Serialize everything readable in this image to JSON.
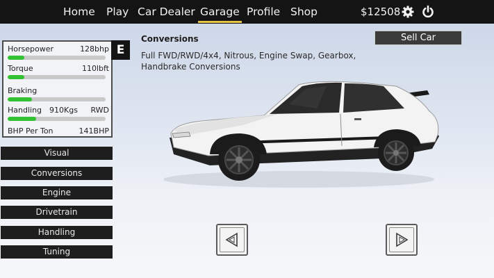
{
  "nav": {
    "items": [
      "Home",
      "Play",
      "Car Dealer",
      "Garage",
      "Profile",
      "Shop"
    ],
    "active": "Garage",
    "money": "$12508",
    "settings_icon": "gear-icon",
    "power_icon": "power-icon",
    "accent": "#e5c447"
  },
  "stats": {
    "horsepower": {
      "label": "Horsepower",
      "value": "128bhp",
      "fill": 0.17
    },
    "torque": {
      "label": "Torque",
      "value": "110lbft",
      "fill": 0.17
    },
    "braking": {
      "label": "Braking",
      "fill": 0.25
    },
    "handling": {
      "label": "Handling",
      "weight": "910Kgs",
      "drive": "RWD",
      "fill": 0.29
    },
    "bhp_per_ton": {
      "label": "BHP Per Ton",
      "value": "141BHP"
    },
    "car_class": "E",
    "bar_color": "#33c233"
  },
  "menu": [
    "Visual",
    "Conversions",
    "Engine",
    "Drivetrain",
    "Handling",
    "Tuning"
  ],
  "description": {
    "title": "Conversions",
    "text": "Full FWD/RWD/4x4, Nitrous, Engine Swap, Gearbox, Handbrake Conversions"
  },
  "sell_button": "Sell Car",
  "arrows": {
    "prev_icon": "left-arrow-icon",
    "next_icon": "right-arrow-icon"
  },
  "car": {
    "body_color": "#f3f3f3",
    "trim_color": "#1a1a1a"
  }
}
